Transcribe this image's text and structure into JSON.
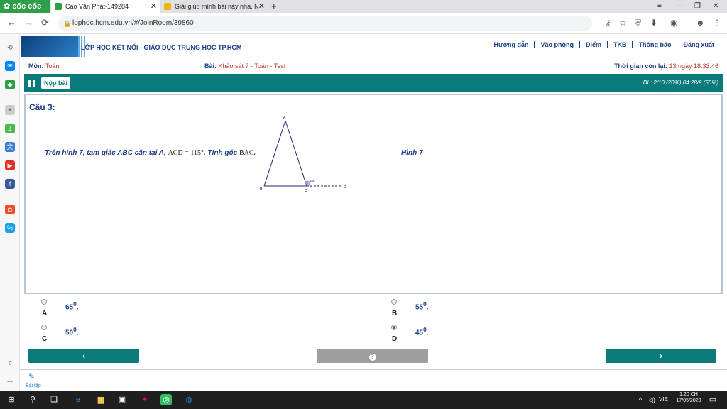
{
  "browser": {
    "brand": "cốc cốc",
    "tabs": [
      {
        "title": "Cao Văn Phát-149284",
        "color": "#2e9e48"
      },
      {
        "title": "Giải giúp mình bài này nha. N",
        "color": "#f0b400"
      }
    ],
    "url": "lophoc.hcm.edu.vn/#/JoinRoom/39860"
  },
  "site": {
    "title": "LỚP HỌC KẾT NỐI - GIÁO DỤC TRUNG HỌC TP.HCM",
    "nav": [
      "Hướng dẫn",
      "Vào phòng",
      "Điểm",
      "TKB",
      "Thông báo",
      "Đăng xuất"
    ]
  },
  "info": {
    "subject_label": "Môn:",
    "subject": "Toán",
    "test_label": "Bài:",
    "test": "Khảo sát 7 - Toán - Test",
    "time_label": "Thời gian còn lại:",
    "time": "13 ngày 18:33:46"
  },
  "toolbar": {
    "submit": "Nộp bài",
    "progress": "ĐL: 2/10 (20%)   04:28/9 (50%)"
  },
  "question": {
    "title": "Câu 3:",
    "text": "Trên hình 7, tam giác ABC cân tại A, ",
    "math1": "ACD = 115°",
    "text2": ". Tính góc ",
    "math2": "BAC",
    "text3": ".",
    "figure_label": "Hình 7",
    "figure_points": [
      "A",
      "B",
      "C",
      "D"
    ],
    "figure_angle": "115°"
  },
  "options": [
    {
      "letter": "A",
      "value": "65",
      "unit": "0",
      "suffix": ".",
      "selected": false
    },
    {
      "letter": "B",
      "value": "55",
      "unit": "0",
      "suffix": ".",
      "selected": false
    },
    {
      "letter": "C",
      "value": "50",
      "unit": "0",
      "suffix": ".",
      "selected": false
    },
    {
      "letter": "D",
      "value": "45",
      "unit": "0",
      "suffix": ".",
      "selected": true
    }
  ],
  "nav_buttons": {
    "prev": "‹",
    "help": "?",
    "next": "›"
  },
  "bottom": {
    "label": "Bài tập"
  },
  "taskbar": {
    "time": "1:20 CH",
    "date": "17/05/2020",
    "lang": "VIE"
  },
  "colors": {
    "teal": "#0b7a7a",
    "navy": "#1b3f8a",
    "red": "#c0392b"
  }
}
